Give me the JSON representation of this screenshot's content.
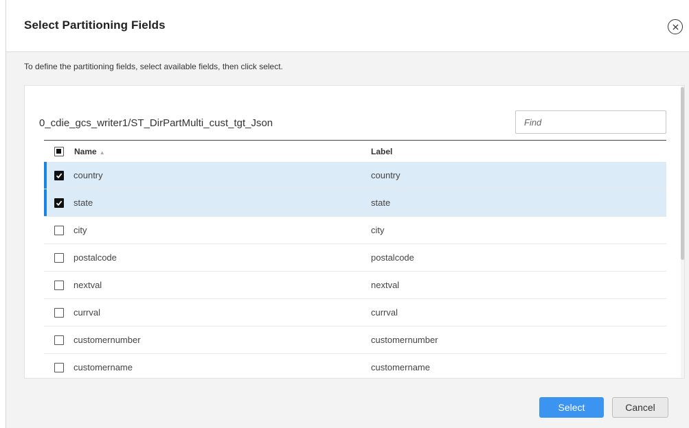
{
  "dialog": {
    "title": "Select Partitioning Fields",
    "instructions": "To define the partitioning fields, select available fields, then click select.",
    "close_icon": "close-circle-icon"
  },
  "panel": {
    "path": "0_cdie_gcs_writer1/ST_DirPartMulti_cust_tgt_Json",
    "find_placeholder": "Find"
  },
  "table": {
    "header": {
      "name": "Name",
      "label": "Label",
      "sort_icon": "sort-ascending-icon",
      "select_all_state": "partial"
    },
    "rows": [
      {
        "name": "country",
        "label": "country",
        "checked": true
      },
      {
        "name": "state",
        "label": "state",
        "checked": true
      },
      {
        "name": "city",
        "label": "city",
        "checked": false
      },
      {
        "name": "postalcode",
        "label": "postalcode",
        "checked": false
      },
      {
        "name": "nextval",
        "label": "nextval",
        "checked": false
      },
      {
        "name": "currval",
        "label": "currval",
        "checked": false
      },
      {
        "name": "customernumber",
        "label": "customernumber",
        "checked": false
      },
      {
        "name": "customername",
        "label": "customername",
        "checked": false
      }
    ]
  },
  "footer": {
    "select_label": "Select",
    "cancel_label": "Cancel"
  },
  "colors": {
    "accent": "#3a94f0",
    "selected_row": "#dcebf8",
    "selected_bar": "#1a84e6"
  }
}
